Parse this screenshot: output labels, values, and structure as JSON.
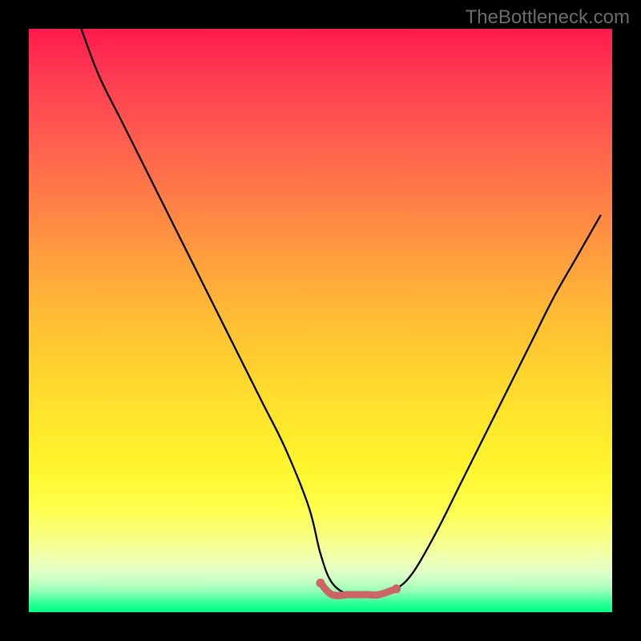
{
  "watermark": "TheBottleneck.com",
  "chart_data": {
    "type": "line",
    "title": "",
    "xlabel": "",
    "ylabel": "",
    "xlim": [
      0,
      100
    ],
    "ylim": [
      0,
      100
    ],
    "grid": false,
    "legend": false,
    "series": [
      {
        "name": "bottleneck-curve",
        "x": [
          9,
          12,
          16,
          20,
          24,
          28,
          32,
          36,
          40,
          44,
          48,
          50,
          52,
          55,
          58,
          60,
          63,
          66,
          70,
          74,
          78,
          82,
          86,
          90,
          94,
          98
        ],
        "y": [
          100,
          92,
          84,
          76,
          68,
          60,
          52,
          44,
          36,
          28,
          18,
          10,
          5,
          3,
          3,
          3,
          4,
          7,
          14,
          22,
          30,
          38,
          46,
          54,
          61,
          68
        ],
        "color": "#000000"
      },
      {
        "name": "optimal-zone",
        "x": [
          50,
          52,
          55,
          58,
          60,
          63
        ],
        "y": [
          5,
          3,
          3,
          3,
          3,
          4
        ],
        "color": "#cc6666"
      }
    ],
    "annotations": []
  }
}
